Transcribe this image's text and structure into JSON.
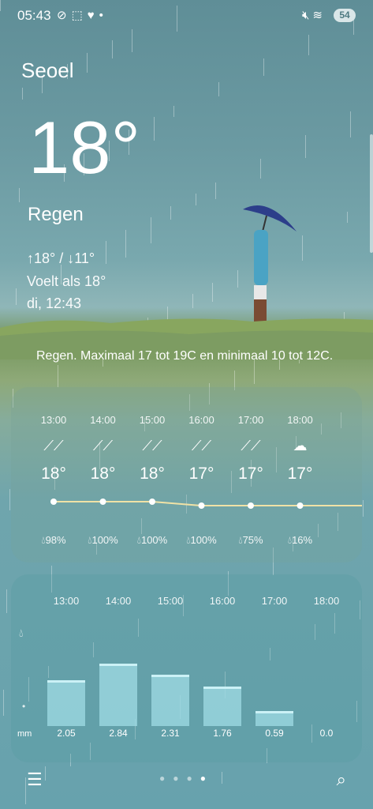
{
  "status_bar": {
    "time": "05:43",
    "battery": "54",
    "left_icons": [
      "sync-off-icon",
      "square-icon",
      "heart-icon",
      "dot-icon"
    ],
    "right_icons": [
      "mute-icon",
      "wifi-icon"
    ]
  },
  "location": {
    "city": "Seoel"
  },
  "current": {
    "temperature": "18°",
    "condition": "Regen",
    "high_low": "↑18° / ↓11°",
    "feels_like": "Voelt als 18°",
    "updated": "di, 12:43"
  },
  "summary": "Regen. Maximaal 17 tot 19C en minimaal 10 tot 12C.",
  "hourly": [
    {
      "time": "13:00",
      "icon": "rain-icon",
      "temp": "18°",
      "precip": "98%"
    },
    {
      "time": "14:00",
      "icon": "rain-icon",
      "temp": "18°",
      "precip": "100%"
    },
    {
      "time": "15:00",
      "icon": "rain-icon",
      "temp": "18°",
      "precip": "100%"
    },
    {
      "time": "16:00",
      "icon": "rain-icon",
      "temp": "17°",
      "precip": "100%"
    },
    {
      "time": "17:00",
      "icon": "rain-icon",
      "temp": "17°",
      "precip": "75%"
    },
    {
      "time": "18:00",
      "icon": "cloud-icon",
      "temp": "17°",
      "precip": "16%"
    }
  ],
  "precip_chart": {
    "unit": "mm",
    "hours": [
      "13:00",
      "14:00",
      "15:00",
      "16:00",
      "17:00",
      "18:00"
    ],
    "values": [
      "2.05",
      "2.84",
      "2.31",
      "1.76",
      "0.59",
      "0.0"
    ]
  },
  "pager": {
    "pages": 4,
    "active": 4
  },
  "colors": {
    "accent_line": "#f0e2a6",
    "bar": "#a0dce6"
  }
}
